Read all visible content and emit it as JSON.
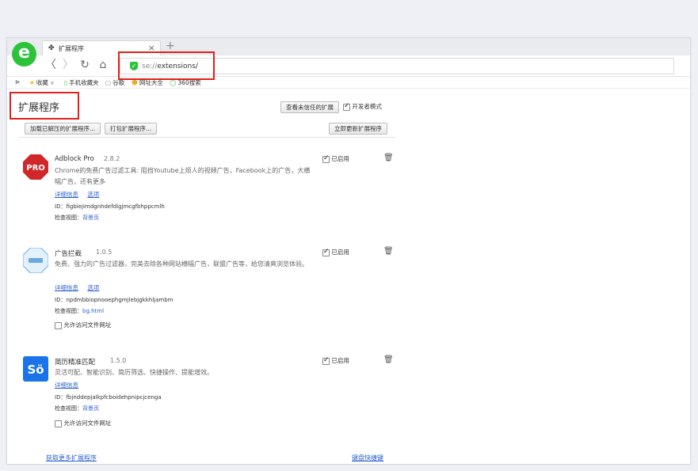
{
  "browser": {
    "tab_title": "扩展程序",
    "tab_close": "×",
    "new_tab": "+",
    "logo_letter": "e",
    "url_scheme": "se://",
    "url_path": "extensions/",
    "nav": {
      "back": "〈",
      "forward": "〉",
      "reload": "↻",
      "home": "⌂"
    }
  },
  "bookmarks": {
    "toggle": "⊳",
    "items": [
      {
        "label": "收藏",
        "icon": "star-icon",
        "glyph": "★",
        "caret": "∨"
      },
      {
        "label": "手机收藏夹",
        "icon": "phone-icon",
        "glyph": "▯"
      },
      {
        "label": "谷歌",
        "icon": "page-icon",
        "glyph": "▢"
      },
      {
        "label": "网址大全",
        "icon": "smiley-icon",
        "glyph": "☻"
      },
      {
        "label": "360搜索",
        "icon": "search360-icon",
        "glyph": "◯"
      }
    ]
  },
  "page": {
    "title": "扩展程序",
    "untrusted_button": "查看未信任的扩展",
    "dev_mode_label": "开发者模式",
    "dev_mode_checked": true,
    "load_unpacked": "加载已解压的扩展程序...",
    "pack_extension": "打包扩展程序...",
    "update_now": "立即更新扩展程序"
  },
  "extensions": [
    {
      "name": "Adblock Pro",
      "version": "2.8.2",
      "description": "Chrome的免费广告过滤工具: 阻挡Youtube上烦人的视频广告，Facebook上的广告，大横幅广告，还有更多",
      "details_link": "详细信息",
      "options_link": "选项",
      "id_label": "ID：",
      "id": "figbiejimdgnhdefdigjmcgfbhppcmlh",
      "view_label": "检查视图：",
      "view_link": "背景页",
      "enabled_label": "已启用",
      "enabled": true,
      "icon": "adblock-pro-icon",
      "icon_text": "PRO",
      "icon_color": "#d0272a"
    },
    {
      "name": "广告拦截",
      "version": "1.0.5",
      "description": "免费、强力的广告过滤器，完美去除各种网站横幅广告，联盟广告等，给您清爽浏览体验。",
      "details_link": "详细信息",
      "options_link": "选项",
      "id_label": "ID：",
      "id": "npdmbbiopnooephgmjlebjgkkhljambm",
      "view_label": "检查视图：",
      "view_link": "bg.html",
      "enabled_label": "已启用",
      "enabled": true,
      "allow_file_label": "允许访问文件网址",
      "allow_file_checked": false,
      "icon": "ad-block-icon",
      "icon_color": "#8fc3ea"
    },
    {
      "name": "简历精准匹配",
      "version": "1.5.0",
      "description": "灵活可配、智能识别、简历筛选、快捷操作、提能增效。",
      "details_link": "详细信息",
      "id_label": "ID：",
      "id": "fbjnddepjalkpfcboidehpnipcjcenga",
      "view_label": "检查视图：",
      "view_link": "背景页",
      "enabled_label": "已启用",
      "enabled": true,
      "allow_file_label": "允许访问文件网址",
      "allow_file_checked": false,
      "icon": "resume-match-icon",
      "icon_text": "Sö",
      "icon_color": "#1a73e8"
    }
  ],
  "footer": {
    "get_more": "获取更多扩展程序",
    "shortcuts": "键盘快捷键"
  },
  "colors": {
    "highlight": "#e0201a",
    "link": "#2e62d1",
    "logo_green": "#2cc33b"
  }
}
